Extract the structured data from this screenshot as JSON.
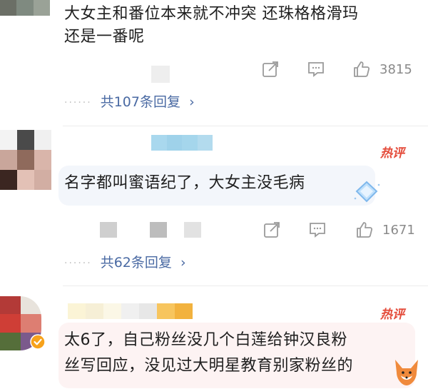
{
  "comments": [
    {
      "text_lines": [
        "大女主和番位本来就不冲突 还珠格格滑玛",
        "还是一番呢"
      ],
      "like_count": "3815",
      "reply_link": "共107条回复",
      "reply_chevron": "›"
    },
    {
      "hot_badge": "热评",
      "text_lines": [
        "名字都叫蜜语纪了，大女主没毛病"
      ],
      "like_count": "1671",
      "reply_link": "共62条回复",
      "reply_chevron": "›"
    },
    {
      "hot_badge": "热评",
      "text_lines": [
        "太6了，自己粉丝没几个白莲给钟汉良粉",
        "丝写回应，没见过大明星教育别家粉丝的"
      ]
    }
  ],
  "icons": {
    "share": "share-icon",
    "comment": "comment-icon",
    "like": "thumbs-up-icon",
    "verified": "verified-badge-icon",
    "emoji": "diamond-sticker-icon",
    "mascot": "fox-mascot-icon"
  },
  "colors": {
    "reply_link": "#4a6aa3",
    "hot_badge": "#e44b3a",
    "bubble": "#f5f6fa",
    "count": "#8a8a8a"
  }
}
